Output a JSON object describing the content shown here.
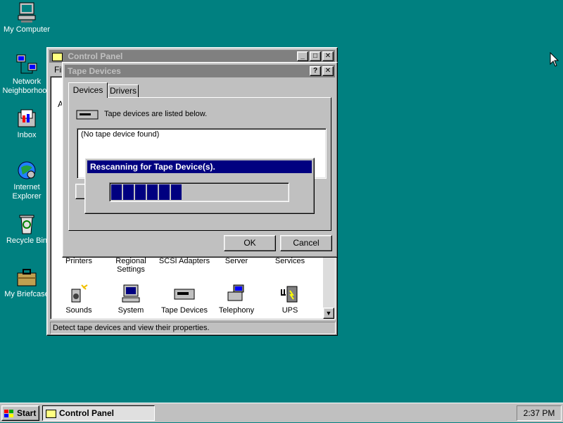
{
  "desktop": {
    "icons": [
      {
        "label": "My Computer",
        "icon": "computer-icon"
      },
      {
        "label": "Network Neighborhood",
        "icon": "network-icon"
      },
      {
        "label": "Inbox",
        "icon": "inbox-icon"
      },
      {
        "label": "Internet Explorer",
        "icon": "ie-globe-icon"
      },
      {
        "label": "Recycle Bin",
        "icon": "recycle-bin-icon"
      },
      {
        "label": "My Briefcase",
        "icon": "briefcase-icon"
      }
    ]
  },
  "control_panel": {
    "title": "Control Panel",
    "menu_first": "File",
    "left_letter": "A",
    "row1": [
      {
        "label": "Printers"
      },
      {
        "label": "Regional Settings"
      },
      {
        "label": "SCSI Adapters"
      },
      {
        "label": "Server"
      },
      {
        "label": "Services"
      }
    ],
    "row2": [
      {
        "label": "Sounds",
        "icon": "speaker-icon"
      },
      {
        "label": "System",
        "icon": "system-icon"
      },
      {
        "label": "Tape Devices",
        "icon": "tape-drive-icon"
      },
      {
        "label": "Telephony",
        "icon": "telephony-icon"
      },
      {
        "label": "UPS",
        "icon": "ups-icon"
      }
    ],
    "status": "Detect tape devices and view their properties."
  },
  "tape_dialog": {
    "title": "Tape Devices",
    "help_label": "?",
    "close_label": "✕",
    "tabs": [
      "Devices",
      "Drivers"
    ],
    "info": "Tape devices are listed below.",
    "list_items": [
      "(No tape device found)"
    ],
    "ok_label": "OK",
    "cancel_label": "Cancel"
  },
  "rescan": {
    "title": "Rescanning for Tape Device(s).",
    "progress": 0.4,
    "progress_blocks": 6
  },
  "taskbar": {
    "start_label": "Start",
    "task_label": "Control Panel",
    "clock": "2:37 PM"
  },
  "colors": {
    "desktop": "#008080",
    "title_active": "#000080",
    "title_inactive": "#808080",
    "face": "#c0c0c0"
  }
}
